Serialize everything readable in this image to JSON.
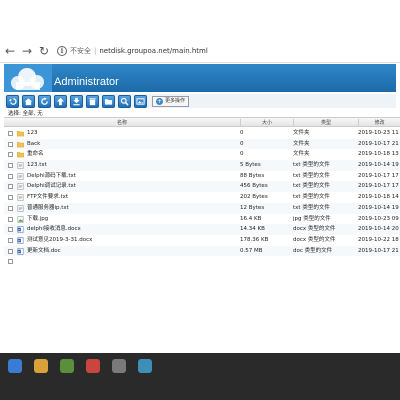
{
  "browser": {
    "insecure_label": "不安全",
    "separator": "|",
    "url": "netdisk.groupoa.net/main.html"
  },
  "app": {
    "title": "Administrator"
  },
  "toolbar": {
    "more_ops_label": "更多操作",
    "buttons": [
      "back-icon",
      "home-icon",
      "refresh-icon",
      "upload-icon",
      "download-icon",
      "delete-icon",
      "new-folder-icon",
      "search-icon",
      "image-icon"
    ]
  },
  "selection": {
    "label": "选择: 全部, 无"
  },
  "table": {
    "headers": {
      "name": "名称",
      "size": "大小",
      "type": "类型",
      "date": "修改"
    },
    "rows": [
      {
        "name": "123",
        "size": "0",
        "type": "文件夹",
        "date": "2019-10-23 11",
        "icon": "folder"
      },
      {
        "name": "Back",
        "size": "0",
        "type": "文件夹",
        "date": "2019-10-17 21",
        "icon": "folder"
      },
      {
        "name": "重命名",
        "size": "0",
        "type": "文件夹",
        "date": "2019-10-18 13",
        "icon": "folder"
      },
      {
        "name": "123.txt",
        "size": "5 Bytes",
        "type": "txt 类型的文件",
        "date": "2019-10-14 19",
        "icon": "text"
      },
      {
        "name": "Delphi源码下载.txt",
        "size": "88 Bytes",
        "type": "txt 类型的文件",
        "date": "2019-10-17 17",
        "icon": "text"
      },
      {
        "name": "Delphi调试记录.txt",
        "size": "456 Bytes",
        "type": "txt 类型的文件",
        "date": "2019-10-17 17",
        "icon": "text"
      },
      {
        "name": "FTP文件要求.txt",
        "size": "202 Bytes",
        "type": "txt 类型的文件",
        "date": "2019-10-18 14",
        "icon": "text"
      },
      {
        "name": "普通服务器ip.txt",
        "size": "12 Bytes",
        "type": "txt 类型的文件",
        "date": "2019-10-14 19",
        "icon": "text"
      },
      {
        "name": "下载.jpg",
        "size": "16.4 KB",
        "type": "jpg 类型的文件",
        "date": "2019-10-23 09",
        "icon": "image"
      },
      {
        "name": "delphi接收消息.docx",
        "size": "14.34 KB",
        "type": "docx 类型的文件",
        "date": "2019-10-14 20",
        "icon": "word"
      },
      {
        "name": "测试意见2019-3-31.docx",
        "size": "178.36 KB",
        "type": "docx 类型的文件",
        "date": "2019-10-22 18",
        "icon": "word"
      },
      {
        "name": "更新文档.doc",
        "size": "0.57 MB",
        "type": "doc 类型的文件",
        "date": "2019-10-17 21",
        "icon": "word"
      },
      {
        "name": "",
        "size": "",
        "type": "",
        "date": "",
        "icon": "none"
      }
    ]
  },
  "colors": {
    "header_blue": "#1d6aa8",
    "toolbar_blue": "#1f6fb6",
    "folder_yellow": "#f2c14e"
  }
}
